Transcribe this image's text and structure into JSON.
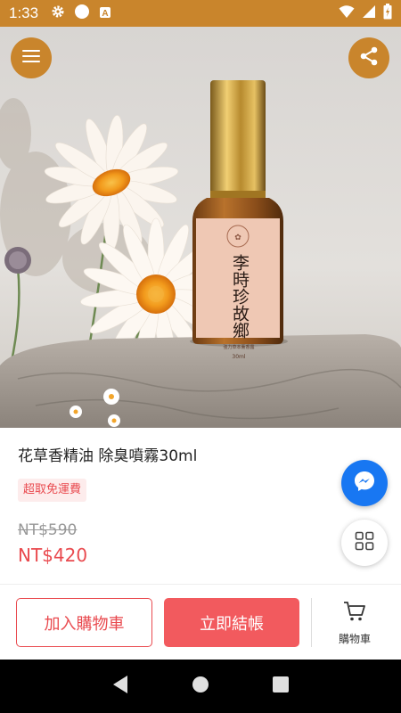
{
  "status_bar": {
    "time": "1:33",
    "left_icons": [
      "gear-icon",
      "circle-icon",
      "a-notification-icon"
    ],
    "right_icons": [
      "wifi-icon",
      "signal-icon",
      "battery-icon"
    ],
    "color": "#c9852c"
  },
  "hero": {
    "bottle_label": "李時珍故鄉",
    "bottle_sublabel": "強力草本薰香露",
    "bottle_volume": "30ml"
  },
  "header": {
    "menu_icon": "hamburger-menu-icon",
    "share_icon": "share-icon"
  },
  "product": {
    "title": "花草香精油 除臭噴霧30ml",
    "badge": "超取免運費",
    "original_price": "NT$590",
    "sale_price": "NT$420"
  },
  "floating": {
    "messenger_icon": "messenger-icon",
    "grid_icon": "grid-icon"
  },
  "actions": {
    "add_to_cart": "加入購物車",
    "checkout": "立即結帳",
    "cart_label": "購物車"
  },
  "colors": {
    "accent": "#c9852c",
    "price_red": "#e94a4f",
    "checkout_bg": "#f25a5e",
    "messenger_blue": "#1877f2"
  },
  "nav_bar": {
    "icons": [
      "back-icon",
      "home-icon",
      "recents-icon"
    ]
  }
}
